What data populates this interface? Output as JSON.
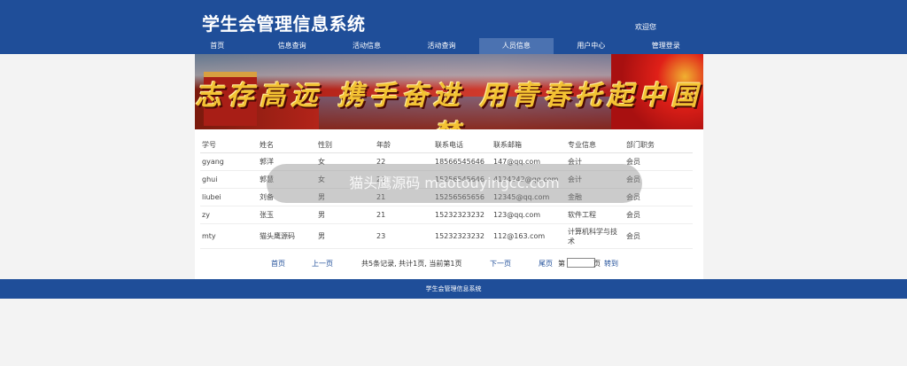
{
  "header": {
    "title": "学生会管理信息系统",
    "welcome": "欢迎您"
  },
  "nav": {
    "items": [
      {
        "label": "首页"
      },
      {
        "label": "信息查询"
      },
      {
        "label": "活动信息"
      },
      {
        "label": "活动查询"
      },
      {
        "label": "人员信息"
      },
      {
        "label": "用户中心"
      },
      {
        "label": "管理登录"
      }
    ],
    "active_index": 4
  },
  "banner": {
    "slogan": "志存高远 携手奋进 用青春托起中国梦"
  },
  "table": {
    "columns": [
      "学号",
      "姓名",
      "性别",
      "年龄",
      "联系电话",
      "联系邮箱",
      "专业信息",
      "部门职务"
    ],
    "rows": [
      [
        "gyang",
        "郭洋",
        "女",
        "22",
        "18566545646",
        "147@qq.com",
        "会计",
        "会员"
      ],
      [
        "ghui",
        "郭慧",
        "女",
        "21",
        "15256545646",
        "4124242@qq.com",
        "会计",
        "会员"
      ],
      [
        "liubei",
        "刘备",
        "男",
        "21",
        "15256565656",
        "12345@qq.com",
        "金融",
        "会员"
      ],
      [
        "zy",
        "张玉",
        "男",
        "21",
        "15232323232",
        "123@qq.com",
        "软件工程",
        "会员"
      ],
      [
        "mty",
        "猫头鹰源码",
        "男",
        "23",
        "15232323232",
        "112@163.com",
        "计算机科学与技术",
        "会员"
      ]
    ]
  },
  "pager": {
    "first": "首页",
    "prev": "上一页",
    "summary": "共5条记录, 共计1页, 当前第1页",
    "next": "下一页",
    "last": "尾页",
    "goto_prefix": "第",
    "goto_suffix": "页",
    "goto_button": "转到"
  },
  "footer": {
    "text": "学生会管理信息系统"
  },
  "overlay": {
    "text": "猫头鹰源码 maotouyingcc.com"
  }
}
